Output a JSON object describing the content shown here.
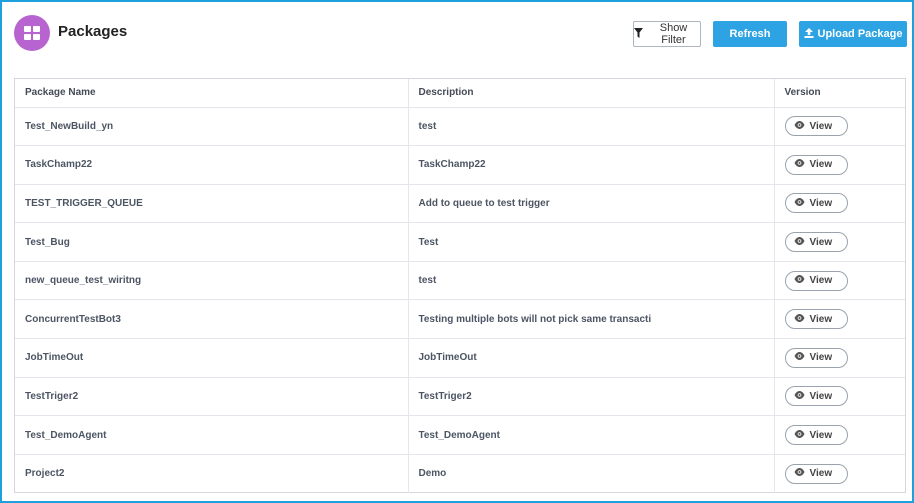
{
  "header": {
    "title": "Packages",
    "app_icon": "grid-icon",
    "accent_color": "#b763d0"
  },
  "toolbar": {
    "show_filter_label": "Show Filter",
    "refresh_label": "Refresh",
    "upload_label": "Upload Package",
    "button_color": "#2ea3e3"
  },
  "table": {
    "columns": [
      "Package Name",
      "Description",
      "Version"
    ],
    "view_label": "View",
    "rows": [
      {
        "name": "Test_NewBuild_yn",
        "description": "test"
      },
      {
        "name": "TaskChamp22",
        "description": "TaskChamp22"
      },
      {
        "name": "TEST_TRIGGER_QUEUE",
        "description": "Add to queue to test trigger"
      },
      {
        "name": "Test_Bug",
        "description": "Test"
      },
      {
        "name": "new_queue_test_wiritng",
        "description": "test"
      },
      {
        "name": "ConcurrentTestBot3",
        "description": "Testing multiple bots will not pick same transacti"
      },
      {
        "name": "JobTimeOut",
        "description": "JobTimeOut"
      },
      {
        "name": "TestTriger2",
        "description": "TestTriger2"
      },
      {
        "name": "Test_DemoAgent",
        "description": "Test_DemoAgent"
      },
      {
        "name": "Project2",
        "description": "Demo"
      }
    ]
  }
}
